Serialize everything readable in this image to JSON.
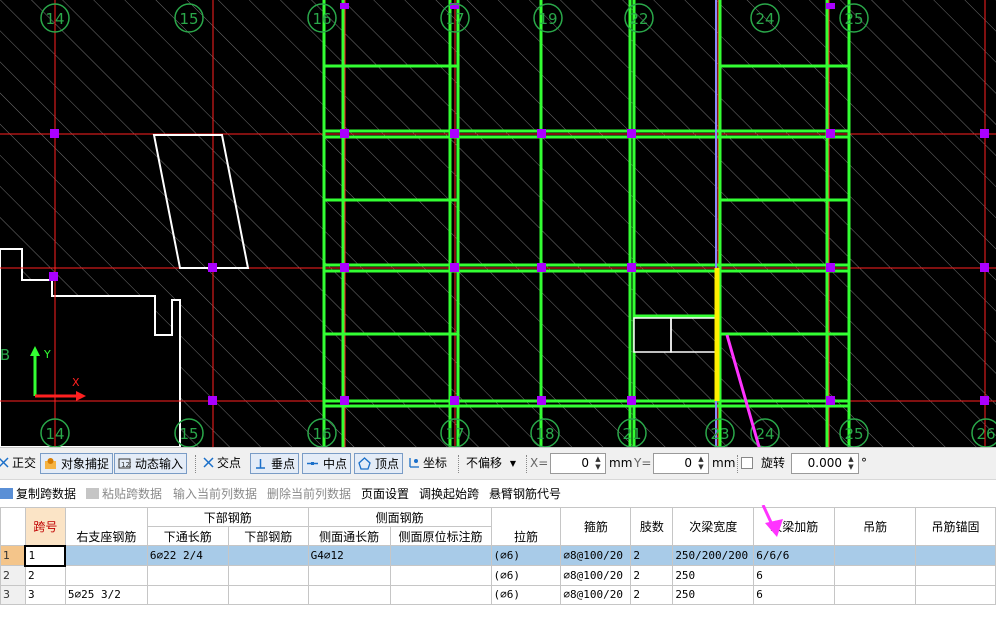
{
  "cad": {
    "grid_top_labels": [
      "14",
      "15",
      "16",
      "17",
      "19",
      "22",
      "24",
      "25"
    ],
    "grid_bottom_labels": [
      "14",
      "15",
      "16",
      "17",
      "18",
      "21",
      "23",
      "24",
      "25",
      "26"
    ],
    "axis_y_label": "Y",
    "axis_x_label": "X",
    "left_edge_label": "B",
    "colors": {
      "background": "#000000",
      "gridline": "#ff2020",
      "beam": "#33ff33",
      "node": "#aa00ff",
      "highlight": "#ffee00",
      "arrow": "#ff33ff",
      "label": "#2aa84a"
    }
  },
  "snap_toolbar": {
    "ortho": "正交",
    "object_snap": "对象捕捉",
    "dynamic_input": "动态输入",
    "intersection": "交点",
    "perpendicular": "垂点",
    "midpoint": "中点",
    "vertex": "顶点",
    "coordinate": "坐标",
    "offset_mode": "不偏移",
    "x_label": "X=",
    "x_value": "0",
    "x_unit": "mm",
    "y_label": "Y=",
    "y_value": "0",
    "y_unit": "mm",
    "rotate_label": "旋转",
    "rotate_value": "0.000",
    "rotate_unit": "°"
  },
  "actions": {
    "copy_span": "复制跨数据",
    "paste_span": "粘贴跨数据",
    "input_current_col": "输入当前列数据",
    "delete_current_col": "删除当前列数据",
    "page_setup": "页面设置",
    "swap_start_span": "调换起始跨",
    "cantilever_code": "悬臂钢筋代号"
  },
  "table": {
    "span_no": "跨号",
    "right_support": "右支座钢筋",
    "bottom_group": "下部钢筋",
    "bottom_through": "下通长筋",
    "bottom_bar": "下部钢筋",
    "side_group": "侧面钢筋",
    "side_through": "侧面通长筋",
    "side_in_situ": "侧面原位标注筋",
    "tie_bar": "拉筋",
    "stirrup": "箍筋",
    "legs": "肢数",
    "secondary_width": "次梁宽度",
    "secondary_extra": "次梁加筋",
    "hanger": "吊筋",
    "hanger_anchor": "吊筋锚固",
    "rows": [
      {
        "row": "1",
        "span": "1",
        "right_support": "",
        "bottom_through": "6⌀22 2/4",
        "bottom_bar": "",
        "side_through": "G4⌀12",
        "side_in_situ": "",
        "tie": "(⌀6)",
        "stirrup": "⌀8@100/20",
        "legs": "2",
        "width": "250/200/200",
        "extra": "6/6/6",
        "hanger": "",
        "anchor": ""
      },
      {
        "row": "2",
        "span": "2",
        "right_support": "",
        "bottom_through": "",
        "bottom_bar": "",
        "side_through": "",
        "side_in_situ": "",
        "tie": "(⌀6)",
        "stirrup": "⌀8@100/20",
        "legs": "2",
        "width": "250",
        "extra": "6",
        "hanger": "",
        "anchor": ""
      },
      {
        "row": "3",
        "span": "3",
        "right_support": "5⌀25 3/2",
        "bottom_through": "",
        "bottom_bar": "",
        "side_through": "",
        "side_in_situ": "",
        "tie": "(⌀6)",
        "stirrup": "⌀8@100/20",
        "legs": "2",
        "width": "250",
        "extra": "6",
        "hanger": "",
        "anchor": ""
      }
    ]
  }
}
